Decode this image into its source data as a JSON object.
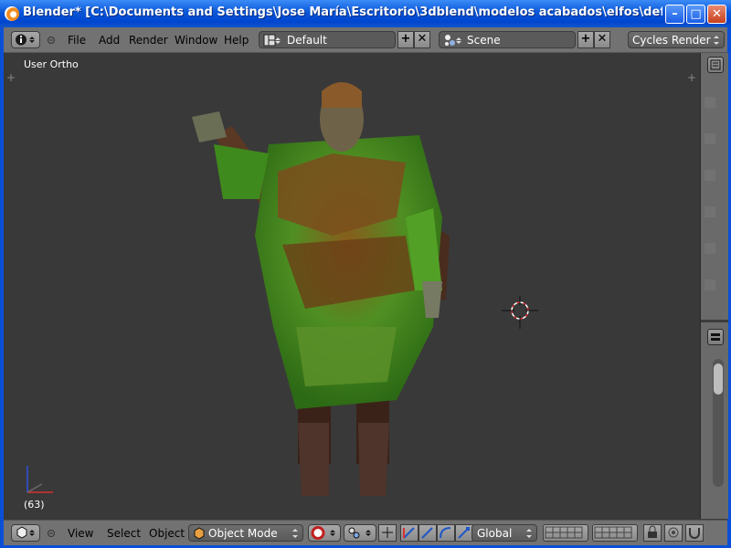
{
  "window": {
    "title": "Blender* [C:\\Documents and Settings\\Jose María\\Escritorio\\3dblend\\modelos acabados\\elfos\\definitivos\\SALVA...",
    "minimize_glyph": "–",
    "maximize_glyph": "□",
    "close_glyph": "✕"
  },
  "top_menu": {
    "items": [
      "File",
      "Add",
      "Render",
      "Window",
      "Help"
    ],
    "layout": "Default",
    "scene": "Scene",
    "render_engine": "Cycles Render",
    "add_glyph": "+",
    "remove_glyph": "✕"
  },
  "viewport": {
    "label": "User Ortho",
    "frame": "(63)",
    "bg_color": "#393939"
  },
  "bottom_bar": {
    "menu": [
      "View",
      "Select",
      "Object"
    ],
    "mode": "Object Mode",
    "orientation": "Global"
  },
  "icons": {
    "editor": "info-icon",
    "viewport_editor": "cube-view-icon",
    "cursor": "3d-cursor-icon",
    "axes": "axis-gizmo-icon"
  }
}
